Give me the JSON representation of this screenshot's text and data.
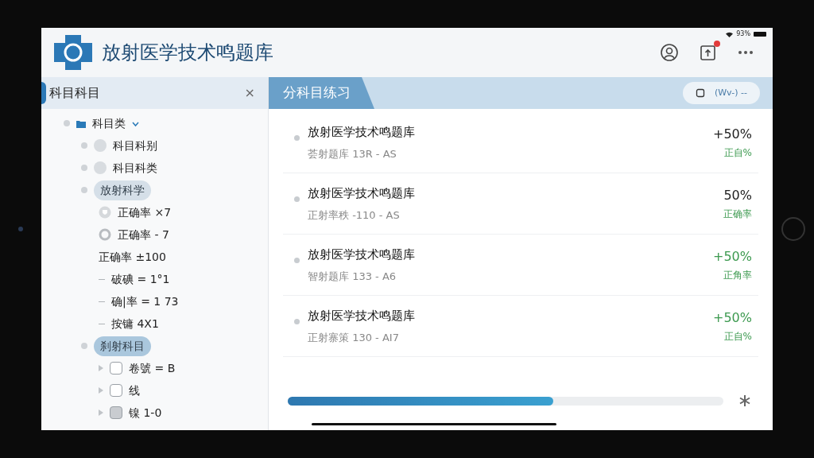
{
  "status_bar": {
    "battery": "93%"
  },
  "header": {
    "title": "放射医学技术鸣题库"
  },
  "sidebar": {
    "title": "科目科目",
    "close": "×",
    "tree": [
      {
        "label": "科目类",
        "kind": "folder",
        "expanded": true,
        "children": [
          {
            "label": "科目科别",
            "kind": "circle"
          },
          {
            "label": "科目科类",
            "kind": "circle"
          },
          {
            "label": "放射科学",
            "kind": "pill",
            "color": "#d5dfe8",
            "children": [
              {
                "label": "正确率 ×7",
                "kind": "shield"
              },
              {
                "label": "正确率 - 7",
                "kind": "ring"
              },
              {
                "label": "正确率 ±100",
                "kind": "plain"
              },
              {
                "label": "破碘 = 1°1",
                "kind": "dash"
              },
              {
                "label": "确|率 = 1 73",
                "kind": "dash"
              },
              {
                "label": "按镛 4X1",
                "kind": "dash"
              }
            ]
          },
          {
            "label": "刹射科目",
            "kind": "pill",
            "color": "#aac7dd",
            "children": [
              {
                "label": "卷號 = B",
                "kind": "checkbox",
                "checked": false
              },
              {
                "label": "线",
                "kind": "checkbox",
                "checked": false
              },
              {
                "label": "镍 1-0",
                "kind": "checkbox",
                "checked": true
              }
            ]
          }
        ]
      }
    ]
  },
  "panel": {
    "tab": "分科目练习",
    "action": "(Wv-) --",
    "rows": [
      {
        "title": "放射医学技术鸣题库",
        "subtitle": "荟射题库 13R - AS",
        "value": "+50%",
        "value_green": false,
        "label": "正自%"
      },
      {
        "title": "放射医学技术鸣题库",
        "subtitle": "正射率秩 -110 - AS",
        "value": "50%",
        "value_green": false,
        "label": "正确率"
      },
      {
        "title": "放射医学技术鸣题库",
        "subtitle": "智射题库 133 - A6",
        "value": "+50%",
        "value_green": true,
        "label": "正角率"
      },
      {
        "title": "放射医学技术鸣题库",
        "subtitle": "正射寨策 130 - AI7",
        "value": "+50%",
        "value_green": true,
        "label": "正自%"
      }
    ],
    "progress": {
      "level": 0.61
    }
  }
}
